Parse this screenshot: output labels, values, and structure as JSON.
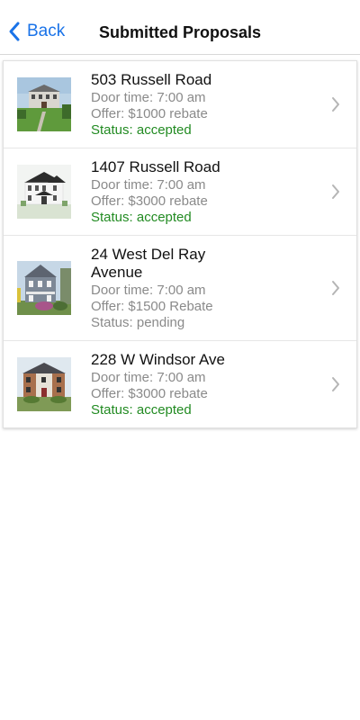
{
  "nav": {
    "back_label": "Back",
    "title": "Submitted Proposals"
  },
  "proposals": [
    {
      "address": "503 Russell Road",
      "door_time": "Door time: 7:00 am",
      "offer": "Offer: $1000 rebate",
      "status": "Status: accepted",
      "status_kind": "accepted"
    },
    {
      "address": "1407 Russell Road",
      "door_time": "Door time: 7:00 am",
      "offer": "Offer: $3000 rebate",
      "status": "Status: accepted",
      "status_kind": "accepted"
    },
    {
      "address": "24 West Del Ray Avenue",
      "door_time": "Door time: 7:00 am",
      "offer": "Offer: $1500 Rebate",
      "status": "Status: pending",
      "status_kind": "pending"
    },
    {
      "address": "228 W Windsor Ave",
      "door_time": "Door time: 7:00 am",
      "offer": "Offer: $3000 rebate",
      "status": "Status: accepted",
      "status_kind": "accepted"
    }
  ],
  "colors": {
    "accent": "#1a73e8",
    "accepted": "#228b22",
    "secondary_text": "#8a8a8a"
  }
}
